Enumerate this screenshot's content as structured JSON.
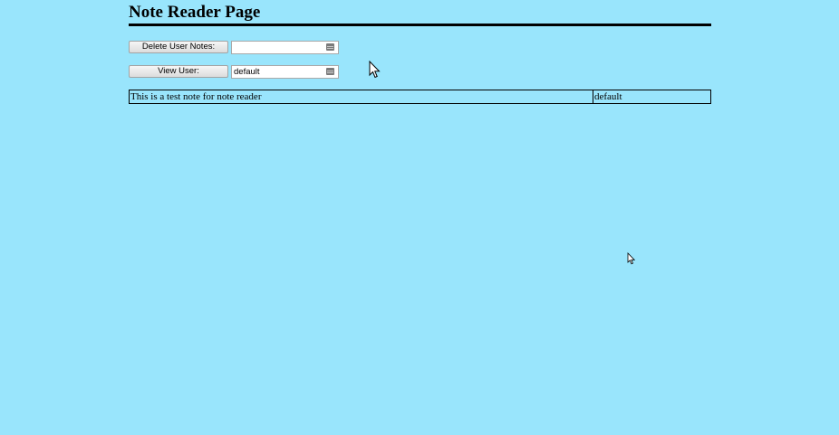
{
  "page": {
    "title": "Note Reader Page"
  },
  "controls": {
    "delete_button_label": "Delete User Notes:",
    "delete_input_value": "",
    "view_button_label": "View User:",
    "view_input_value": "default"
  },
  "notes_table": {
    "rows": [
      {
        "note": "This is a test note for note reader",
        "user": "default"
      }
    ]
  },
  "colors": {
    "background": "#99e5fc"
  },
  "icons": {
    "field_icon": "keyboard-icon",
    "cursor": "mouse-pointer-icon"
  }
}
